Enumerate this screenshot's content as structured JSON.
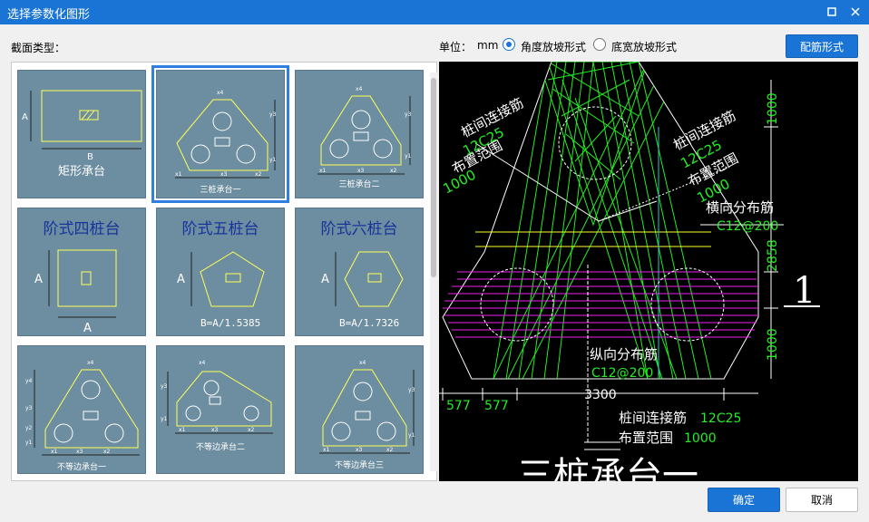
{
  "window": {
    "title": "选择参数化图形",
    "maximize_icon": "maximize-icon",
    "close_icon": "close-icon"
  },
  "section_label": "截面类型：",
  "unit": {
    "label": "单位：",
    "value": "mm"
  },
  "options": [
    {
      "label": "角度放坡形式",
      "checked": true
    },
    {
      "label": "底宽放坡形式",
      "checked": false
    }
  ],
  "buttons": {
    "rebar_form": "配筋形式",
    "ok": "确定",
    "cancel": "取消"
  },
  "thumbs": {
    "rect": {
      "caption": "矩形承台",
      "dim_a": "A",
      "dim_b": "B"
    },
    "tri1": {
      "caption": "三桩承台一"
    },
    "tri2": {
      "caption": "三桩承台二"
    },
    "step4": {
      "title": "阶式四桩台",
      "dim_a": "A",
      "dim_b": "A"
    },
    "step5": {
      "title": "阶式五桩台",
      "dim_a": "A",
      "formula": "B=A/1.5385"
    },
    "step6": {
      "title": "阶式六桩台",
      "dim_a": "A",
      "formula": "B=A/1.7326"
    },
    "uneq1": {
      "caption": "不等边承台一"
    },
    "uneq2": {
      "caption": "不等边承台二"
    },
    "uneq3": {
      "caption": "不等边承台三"
    },
    "dims": {
      "x1": "x1",
      "x2": "x2",
      "x3": "x3",
      "x4": "x4",
      "y1": "y1",
      "y2": "y2",
      "y3": "y3",
      "y4": "y4"
    }
  },
  "preview": {
    "left_label_1": "桩间连接筋",
    "left_label_2": "12C25",
    "left_label_3": "布置范围",
    "left_label_4": "1000",
    "right_label_1": "桩间连接筋",
    "right_label_2": "12C25",
    "right_label_3": "布置范围",
    "right_label_4": "1000",
    "horiz_label": "横向分布筋",
    "horiz_value": "C12@200",
    "vert_label": "纵向分布筋",
    "vert_value": "C12@200",
    "bottom_label_1": "桩间连接筋",
    "bottom_value_1": "12C25",
    "bottom_label_2": "布置范围",
    "bottom_value_2": "1000",
    "dim_1000_top": "1000",
    "dim_2858": "2858",
    "dim_1000_bottom": "1000",
    "dim_3300": "3300",
    "dim_577a": "577",
    "dim_577b": "577",
    "section_mark": "1",
    "title": "三桩承台一"
  }
}
